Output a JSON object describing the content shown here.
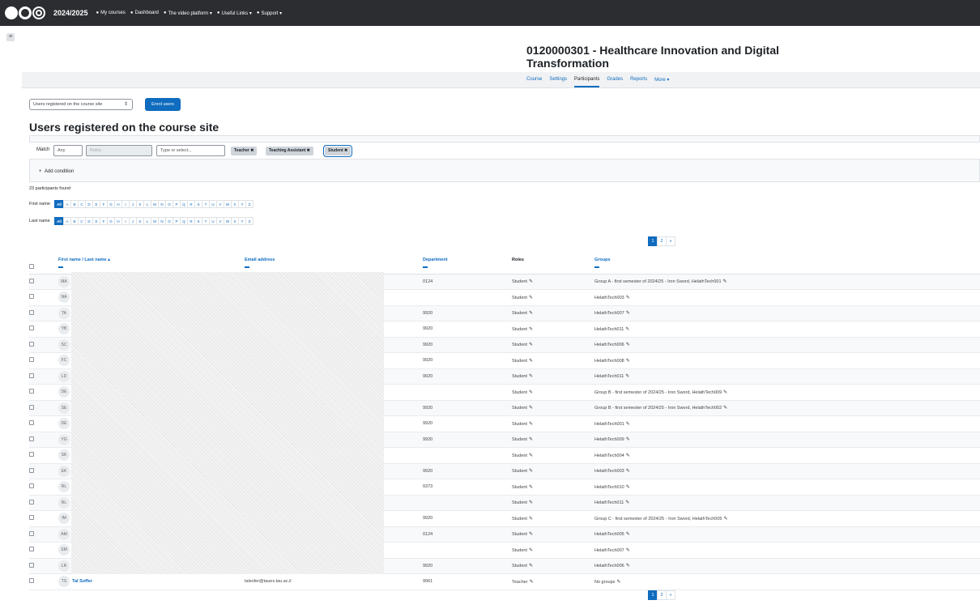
{
  "topbar": {
    "year": "2024/2025",
    "nav": [
      {
        "icon": "home-icon",
        "label": "My courses"
      },
      {
        "icon": "dashboard-icon",
        "label": "Dashboard"
      },
      {
        "icon": "video-icon",
        "label": "The video platform ▾"
      },
      {
        "icon": "link-icon",
        "label": "Useful Links ▾"
      },
      {
        "icon": "support-icon",
        "label": "Support ▾"
      }
    ]
  },
  "course": {
    "title": "0120000301 - Healthcare Innovation and Digital Transformation"
  },
  "secnav": [
    "Course",
    "Settings",
    "Participants",
    "Grades",
    "Reports",
    "More ▾"
  ],
  "enrol": {
    "select": "Users registered on the course site",
    "button": "Enrol users"
  },
  "heading": "Users registered on the course site",
  "filter": {
    "match_label": "Match",
    "match_value": "Any",
    "roles_placeholder": "Roles",
    "type_placeholder": "Type or select...",
    "tags": [
      "Teacher ✖",
      "Teaching Assistant ✖",
      "Student ✖"
    ],
    "add_condition": "Add condition"
  },
  "found": "23 participants found",
  "initials": {
    "first_label": "First name",
    "last_label": "Last name",
    "all": "All",
    "letters": [
      "A",
      "B",
      "C",
      "D",
      "E",
      "F",
      "G",
      "H",
      "I",
      "J",
      "K",
      "L",
      "M",
      "N",
      "O",
      "P",
      "Q",
      "R",
      "S",
      "T",
      "U",
      "V",
      "W",
      "X",
      "Y",
      "Z"
    ]
  },
  "pager": [
    "1",
    "2",
    "»"
  ],
  "table": {
    "headers": [
      "First name / Last name ▴",
      "Email address",
      "Department",
      "Roles",
      "Groups"
    ],
    "rows": [
      {
        "initials": "MA",
        "name": "",
        "email": "",
        "dept": "0124",
        "role": "Student",
        "groups": "Group A - first semester of 2024/25 - Iron Sword, HelathTech001"
      },
      {
        "initials": "NA",
        "name": "",
        "email": "",
        "dept": "",
        "role": "Student",
        "groups": "HelathTech003"
      },
      {
        "initials": "TA",
        "name": "",
        "email": "",
        "dept": "9920",
        "role": "Student",
        "groups": "HelathTech007"
      },
      {
        "initials": "YB",
        "name": "",
        "email": "",
        "dept": "9920",
        "role": "Student",
        "groups": "HelathTech011"
      },
      {
        "initials": "SC",
        "name": "",
        "email": "",
        "dept": "9920",
        "role": "Student",
        "groups": "HelathTech006"
      },
      {
        "initials": "FC",
        "name": "",
        "email": "",
        "dept": "9920",
        "role": "Student",
        "groups": "HelathTech008"
      },
      {
        "initials": "LD",
        "name": "",
        "email": "",
        "dept": "9920",
        "role": "Student",
        "groups": "HelathTech011"
      },
      {
        "initials": "DE",
        "name": "",
        "email": "",
        "dept": "",
        "role": "Student",
        "groups": "Group B - first semester of 2024/25 - Iron Sword, HelathTech009"
      },
      {
        "initials": "SE",
        "name": "",
        "email": "",
        "dept": "9920",
        "role": "Student",
        "groups": "Group B - first semester of 2024/25 - Iron Sword, HelathTech002"
      },
      {
        "initials": "DE",
        "name": "",
        "email": "",
        "dept": "9920",
        "role": "Student",
        "groups": "HelathTech001"
      },
      {
        "initials": "YG",
        "name": "",
        "email": "",
        "dept": "9920",
        "role": "Student",
        "groups": "HelathTech009"
      },
      {
        "initials": "SK",
        "name": "",
        "email": "",
        "dept": "",
        "role": "Student",
        "groups": "HelathTech004"
      },
      {
        "initials": "EK",
        "name": "",
        "email": "",
        "dept": "9920",
        "role": "Student",
        "groups": "HelathTech003"
      },
      {
        "initials": "RL",
        "name": "",
        "email": "",
        "dept": "0373",
        "role": "Student",
        "groups": "HelathTech010"
      },
      {
        "initials": "RL",
        "name": "",
        "email": "",
        "dept": "",
        "role": "Student",
        "groups": "HelathTech011"
      },
      {
        "initials": "IM",
        "name": "",
        "email": "",
        "dept": "9920",
        "role": "Student",
        "groups": "Group C - first semester of 2024/25 - Iron Sword, HelathTech005"
      },
      {
        "initials": "AM",
        "name": "",
        "email": "",
        "dept": "0124",
        "role": "Student",
        "groups": "HelathTech005"
      },
      {
        "initials": "SM",
        "name": "",
        "email": "",
        "dept": "",
        "role": "Student",
        "groups": "HelathTech007"
      },
      {
        "initials": "LR",
        "name": "",
        "email": "",
        "dept": "9920",
        "role": "Student",
        "groups": "HelathTech006"
      },
      {
        "initials": "TS",
        "name": "Tal Soffer",
        "email": "talsofer@tauex.tau.ac.il",
        "dept": "9961",
        "role": "Teacher",
        "groups": "No groups"
      }
    ]
  }
}
